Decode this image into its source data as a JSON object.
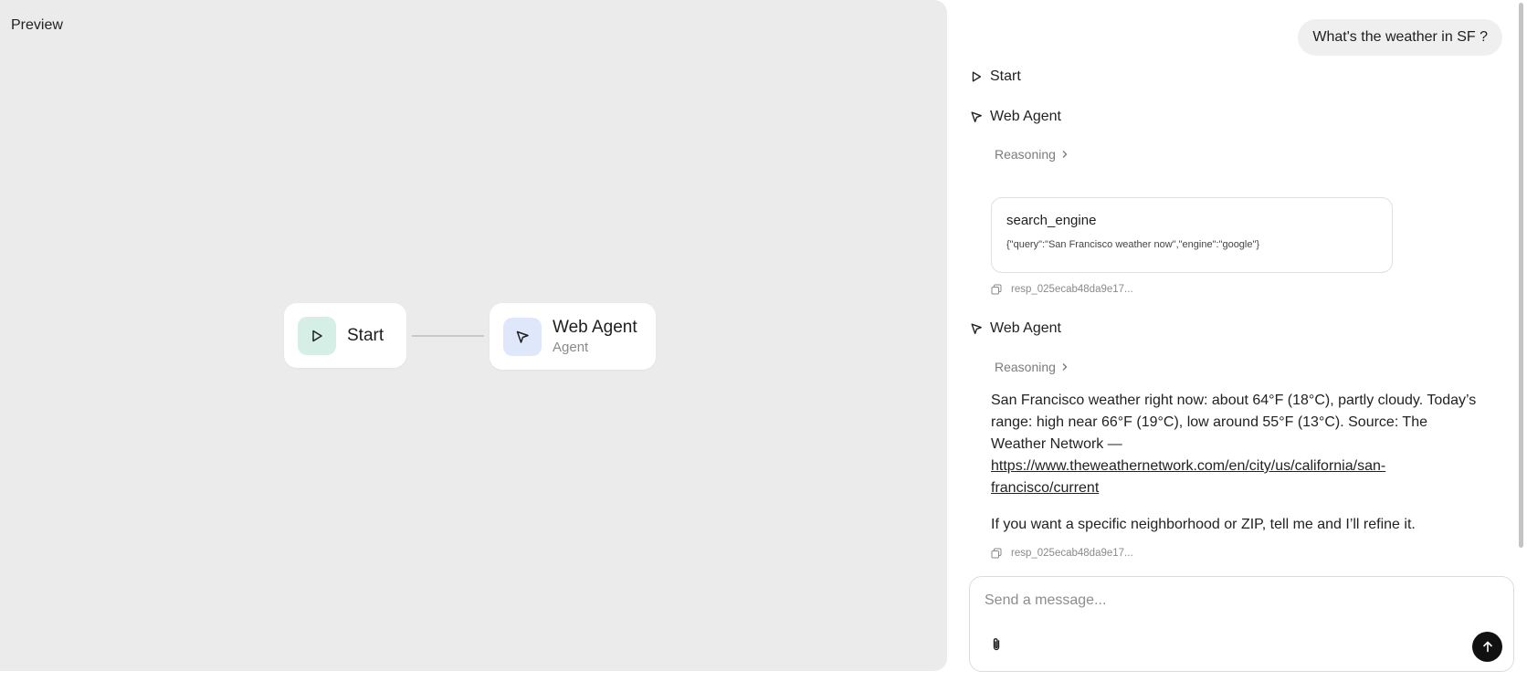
{
  "preview": {
    "title": "Preview",
    "nodes": {
      "start": {
        "label": "Start",
        "icon": "play-icon",
        "icon_bg": "#d6efe6"
      },
      "agent": {
        "label": "Web Agent",
        "sublabel": "Agent",
        "icon": "cursor-icon",
        "icon_bg": "#dfe8fb"
      }
    }
  },
  "chat": {
    "user_message": "What's the weather in SF ?",
    "steps": {
      "start": {
        "label": "Start",
        "icon": "play-icon"
      },
      "agent1": {
        "label": "Web Agent",
        "icon": "cursor-icon",
        "reasoning": "Reasoning"
      },
      "agent2": {
        "label": "Web Agent",
        "icon": "cursor-icon",
        "reasoning": "Reasoning"
      }
    },
    "tool_call": {
      "name": "search_engine",
      "args": "{\"query\":\"San Francisco weather now\",\"engine\":\"google\"}"
    },
    "response_ids": [
      "resp_025ecab48da9e17...",
      "resp_025ecab48da9e17..."
    ],
    "answer": {
      "text": "San Francisco weather right now: about 64°F (18°C), partly cloudy. Today’s range: high near 66°F (19°C), low around 55°F (13°C). Source: The Weather Network —",
      "link": "https://www.theweathernetwork.com/en/city/us/california/san-francisco/current",
      "follow_up": "If you want a specific neighborhood or ZIP, tell me and I’ll refine it."
    },
    "composer": {
      "placeholder": "Send a message...",
      "attach_icon": "paperclip-icon",
      "send_icon": "arrow-up-icon"
    }
  }
}
